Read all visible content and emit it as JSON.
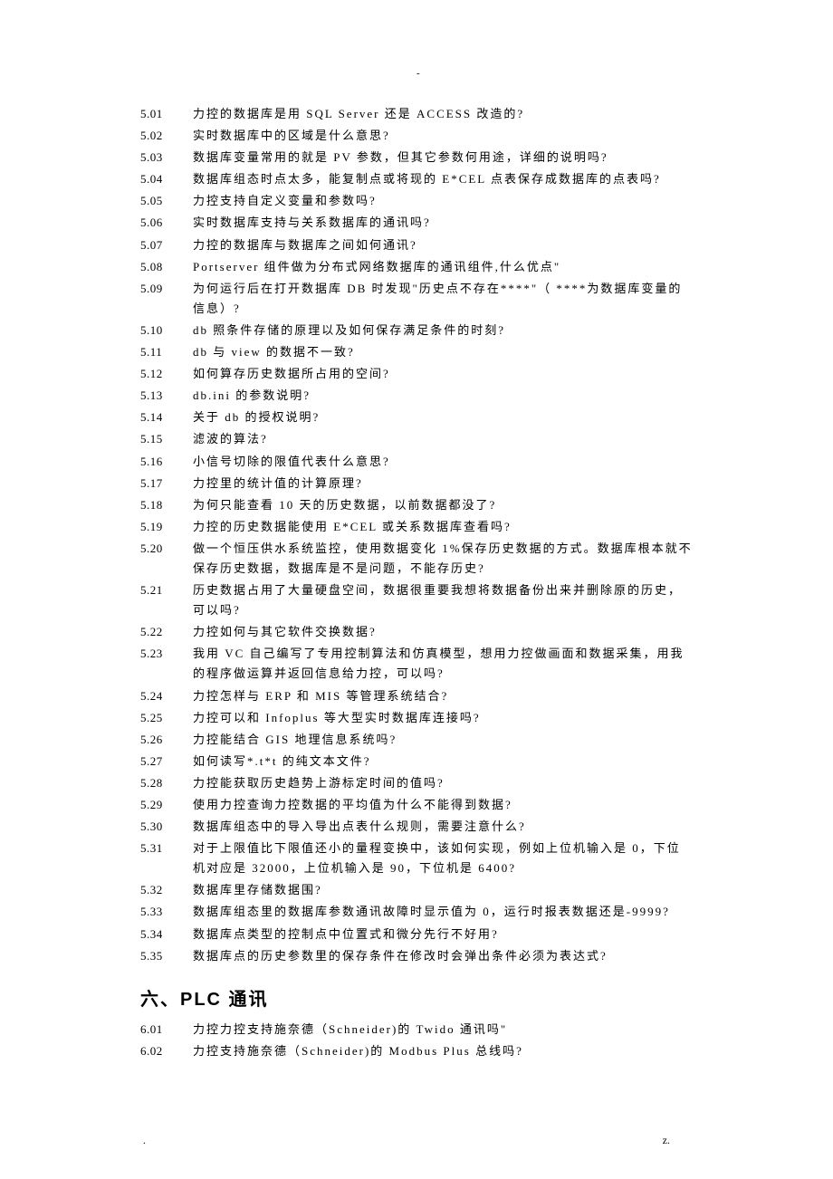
{
  "topMarker": "-",
  "section5": {
    "items": [
      {
        "num": "5.01",
        "text": "力控的数据库是用 SQL Server 还是 ACCESS 改造的?"
      },
      {
        "num": "5.02",
        "text": "实时数据库中的区域是什么意思?"
      },
      {
        "num": "5.03",
        "text": "数据库变量常用的就是 PV 参数，但其它参数何用途，详细的说明吗?"
      },
      {
        "num": "5.04",
        "text": "数据库组态时点太多，能复制点或将现的 E*CEL 点表保存成数据库的点表吗?"
      },
      {
        "num": "5.05",
        "text": "力控支持自定义变量和参数吗?"
      },
      {
        "num": "5.06",
        "text": "实时数据库支持与关系数据库的通讯吗?"
      },
      {
        "num": "5.07",
        "text": "力控的数据库与数据库之间如何通讯?"
      },
      {
        "num": "5.08",
        "text": "Portserver 组件做为分布式网络数据库的通讯组件,什么优点\""
      },
      {
        "num": "5.09",
        "text": "为何运行后在打开数据库 DB 时发现\"历史点不存在****\"（ ****为数据库变量的信息）?"
      },
      {
        "num": "5.10",
        "text": "db 照条件存储的原理以及如何保存满足条件的时刻?"
      },
      {
        "num": "5.11",
        "text": "db 与 view 的数据不一致?"
      },
      {
        "num": "5.12",
        "text": "如何算存历史数据所占用的空间?"
      },
      {
        "num": "5.13",
        "text": "db.ini 的参数说明?"
      },
      {
        "num": "5.14",
        "text": "关于 db 的授权说明?"
      },
      {
        "num": "5.15",
        "text": "滤波的算法?"
      },
      {
        "num": "5.16",
        "text": "小信号切除的限值代表什么意思?"
      },
      {
        "num": "5.17",
        "text": "力控里的统计值的计算原理?"
      },
      {
        "num": "5.18",
        "text": "为何只能查看 10 天的历史数据，以前数据都没了?"
      },
      {
        "num": "5.19",
        "text": "力控的历史数据能使用 E*CEL 或关系数据库查看吗?"
      },
      {
        "num": "5.20",
        "text": "做一个恒压供水系统监控，使用数据变化 1%保存历史数据的方式。数据库根本就不保存历史数据，数据库是不是问题，不能存历史?"
      },
      {
        "num": "5.21",
        "text": "历史数据占用了大量硬盘空间，数据很重要我想将数据备份出来并删除原的历史，可以吗?"
      },
      {
        "num": "5.22",
        "text": "力控如何与其它软件交换数据?"
      },
      {
        "num": "5.23",
        "text": "我用 VC 自己编写了专用控制算法和仿真模型，想用力控做画面和数据采集，用我的程序做运算并返回信息给力控，可以吗?"
      },
      {
        "num": "5.24",
        "text": "力控怎样与 ERP 和 MIS 等管理系统结合?"
      },
      {
        "num": "5.25",
        "text": "力控可以和 Infoplus 等大型实时数据库连接吗?"
      },
      {
        "num": "5.26",
        "text": "力控能结合 GIS 地理信息系统吗?"
      },
      {
        "num": "5.27",
        "text": "如何读写*.t*t 的纯文本文件?"
      },
      {
        "num": "5.28",
        "text": "力控能获取历史趋势上游标定时间的值吗?"
      },
      {
        "num": "5.29",
        "text": "使用力控查询力控数据的平均值为什么不能得到数据?"
      },
      {
        "num": "5.30",
        "text": "数据库组态中的导入导出点表什么规则，需要注意什么?"
      },
      {
        "num": "5.31",
        "text": "对于上限值比下限值还小的量程变换中，该如何实现，例如上位机输入是 0，下位机对应是 32000，上位机输入是 90，下位机是 6400?"
      },
      {
        "num": "5.32",
        "text": "数据库里存储数据围?"
      },
      {
        "num": "5.33",
        "text": "数据库组态里的数据库参数通讯故障时显示值为 0，运行时报表数据还是-9999?"
      },
      {
        "num": "5.34",
        "text": "数据库点类型的控制点中位置式和微分先行不好用?"
      },
      {
        "num": "5.35",
        "text": "数据库点的历史参数里的保存条件在修改时会弹出条件必须为表达式?"
      }
    ]
  },
  "section6": {
    "heading": "六、PLC 通讯",
    "items": [
      {
        "num": "6.01",
        "text": "力控力控支持施奈德（Schneider)的 Twido 通讯吗\""
      },
      {
        "num": "6.02",
        "text": "力控支持施奈德（Schneider)的 Modbus Plus 总线吗?"
      }
    ]
  },
  "footer": {
    "dot": ".",
    "z": "z."
  }
}
